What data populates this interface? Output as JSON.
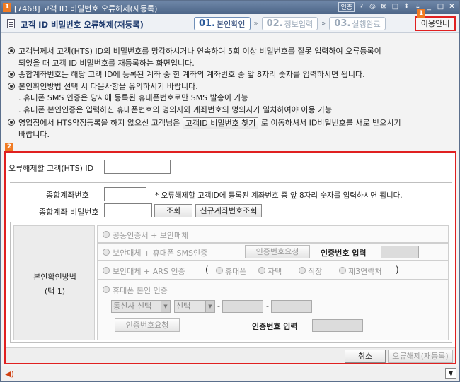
{
  "window": {
    "number": "1",
    "title": "[7468] 고객 ID 비밀번호 오류해제(재등록)",
    "icons": [
      "인증",
      "?",
      "◎",
      "⊠",
      "□",
      "⇞",
      "↓",
      "_",
      "□",
      "✕"
    ]
  },
  "header": {
    "title": "고객 ID 비밀번호 오류해제(재등록)",
    "steps": [
      {
        "num": "01.",
        "label": "본인확인"
      },
      {
        "num": "02.",
        "label": "정보입력"
      },
      {
        "num": "03.",
        "label": "실행완료"
      }
    ],
    "guide_button": "이용안내",
    "badge1": "1"
  },
  "notes": {
    "line1": "고객님께서 고객(HTS) ID의 비밀번호를 망각하시거나 연속하여 5회 이상 비밀번호를 잘못 입력하여 오류등록이",
    "line1b": "되었을 때 고객 ID 비밀번호를 재등록하는 화면입니다.",
    "line2": "종합계좌번호는 해당 고객 ID에 등록된 계좌 중 한 계좌의 계좌번호 중 앞 8자리 숫자를 입력하시면 됩니다.",
    "line3": "본인확인방법 선택 시 다음사항을 유의하시기 바랍니다.",
    "sub1": ". 휴대폰 SMS 인증은 당사에 등록된 휴대폰번호로만 SMS 발송이 가능",
    "sub2": ". 휴대폰 본인인증은 입력하신 휴대폰번호의 명의자와 계좌번호의 명의자가 일치하여야 이용 가능",
    "line4a": "영업점에서 HTS약정등록을 하지 않으신 고객님은",
    "line4_button": "고객ID 비밀번호 찾기",
    "line4b": "로 이동하셔서 ID비밀번호를 새로 받으시기",
    "line4c": "바랍니다."
  },
  "form": {
    "badge2": "2",
    "id_label": "오류해제할 고객(HTS) ID",
    "id_value": "",
    "account_label": "종합계좌번호",
    "account_value": "",
    "account_hint": "* 오류해제할 고객ID에 등록된 계좌번호 중 앞 8자리 숫자를 입력하시면 됩니다.",
    "password_label": "종합계좌 비밀번호",
    "password_value": "",
    "search_button": "조회",
    "new_account_button": "신규계좌번호조회"
  },
  "auth": {
    "left_label1": "본인확인방법",
    "left_label2": "(택 1)",
    "opt1": "공동인증서 + 보안매체",
    "opt2": "보안매체 + 휴대폰 SMS인증",
    "opt2_button": "인증번호요청",
    "opt2_code_label": "인증번호 입력",
    "opt3": "보안매체 + ARS 인증",
    "opt3_open": "(",
    "opt3_a": "휴대폰",
    "opt3_b": "자택",
    "opt3_c": "직장",
    "opt3_d": "제3연락처",
    "opt3_close": ")",
    "opt4": "휴대폰 본인 인증",
    "carrier_select": "통신사 선택",
    "phone_prefix_select": "선택",
    "dash": "-",
    "opt4_button": "인증번호요청",
    "opt4_code_label": "인증번호 입력"
  },
  "actions": {
    "cancel": "취소",
    "confirm": "오류해제(재등록)"
  }
}
